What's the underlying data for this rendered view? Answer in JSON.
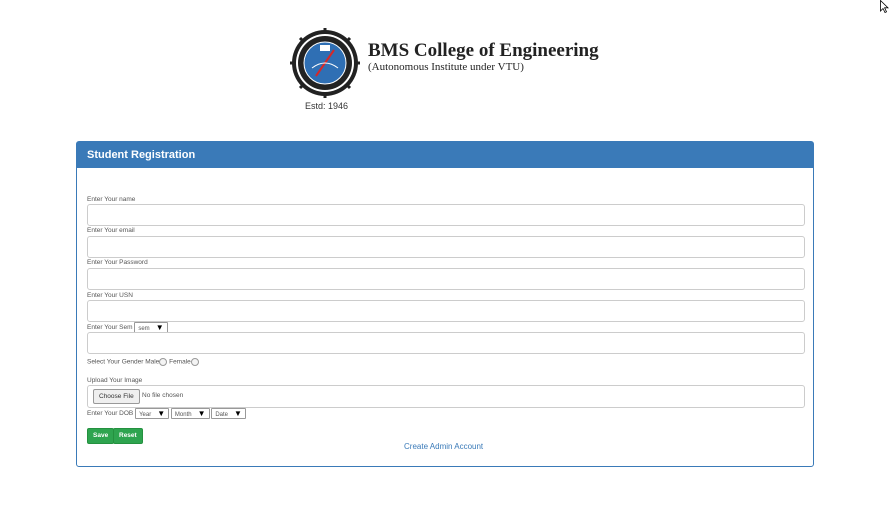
{
  "header": {
    "college_name": "BMS College of Engineering",
    "college_subtitle": "(Autonomous Institute under VTU)",
    "established": "Estd: 1946"
  },
  "form": {
    "title": "Student Registration",
    "fields": {
      "name_label": "Enter Your name",
      "email_label": "Enter Your email",
      "password_label": "Enter Your Password",
      "usn_label": "Enter Your USN",
      "sem_label": "Enter Your Sem",
      "sem_select": "sem",
      "gender_label": "Select Your Gender",
      "gender_male": "Male",
      "gender_female": "Female",
      "image_label": "Upload Your Image",
      "choose_file": "Choose File",
      "file_status": "No file chosen",
      "dob_label": "Enter Your DOB",
      "dob_year": "Year",
      "dob_month": "Month",
      "dob_date": "Date"
    },
    "buttons": {
      "save": "Save",
      "reset": "Reset"
    },
    "admin_link": "Create Admin Account"
  },
  "colors": {
    "panel_primary": "#3a7ab8",
    "button_success": "#2ea44f"
  }
}
